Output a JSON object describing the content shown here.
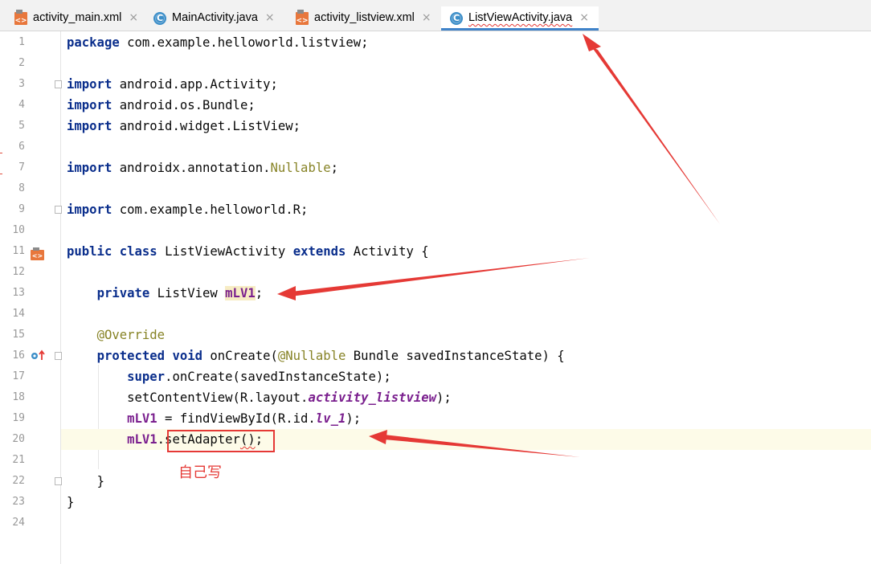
{
  "tabs": [
    {
      "label": "activity_main.xml",
      "icon": "xml-file-icon",
      "active": false
    },
    {
      "label": "MainActivity.java",
      "icon": "java-class-icon",
      "active": false
    },
    {
      "label": "activity_listview.xml",
      "icon": "xml-file-icon",
      "active": false
    },
    {
      "label": "ListViewActivity.java",
      "icon": "java-class-icon",
      "active": true
    }
  ],
  "tab_close_glyph": "×",
  "line_numbers": [
    "1",
    "2",
    "3",
    "4",
    "5",
    "6",
    "7",
    "8",
    "9",
    "10",
    "11",
    "12",
    "13",
    "14",
    "15",
    "16",
    "17",
    "18",
    "19",
    "20",
    "21",
    "22",
    "23",
    "24"
  ],
  "code": {
    "l1": {
      "kw": "package",
      "rest": " com.example.helloworld.listview;"
    },
    "l3": {
      "kw": "import",
      "rest": " android.app.Activity;"
    },
    "l4": {
      "kw": "import",
      "rest": " android.os.Bundle;"
    },
    "l5": {
      "kw": "import",
      "rest": " android.widget.ListView;"
    },
    "l7": {
      "kw": "import",
      "pre": " androidx.annotation.",
      "ann": "Nullable",
      "post": ";"
    },
    "l9": {
      "kw": "import",
      "rest": " com.example.helloworld.R;"
    },
    "l11": {
      "kw1": "public",
      "kw2": "class",
      "name": " ListViewActivity ",
      "kw3": "extends",
      "rest": " Activity {"
    },
    "l13": {
      "kw": "private",
      "type": " ListView ",
      "field": "mLV1",
      "post": ";"
    },
    "l15": {
      "ann": "@Override"
    },
    "l16": {
      "kw1": "protected",
      "kw2": "void",
      "name": " onCreate(",
      "ann": "@Nullable",
      "rest": " Bundle savedInstanceState) {"
    },
    "l17": {
      "kw": "super",
      "rest": ".onCreate(savedInstanceState);"
    },
    "l18": {
      "pre": "setContentView(R.layout.",
      "field": "activity_listview",
      "post": ");"
    },
    "l19": {
      "field": "mLV1",
      "pre": " = findViewById(R.id.",
      "field2": "lv_1",
      "post": ");"
    },
    "l20": {
      "field": "mLV1",
      "pre": ".setAdapter",
      "err": "()",
      "post": ";"
    },
    "l22": {
      "text": "}"
    },
    "l23": {
      "text": "}"
    }
  },
  "annotation": {
    "text": "自己写",
    "color": "#e53935"
  },
  "colors": {
    "keyword": "#0a2e8c",
    "annotation": "#878326",
    "field": "#7a1f8e",
    "active_tab_underline": "#4083c9",
    "current_line": "#fdfbe8",
    "arrow": "#e53935"
  }
}
